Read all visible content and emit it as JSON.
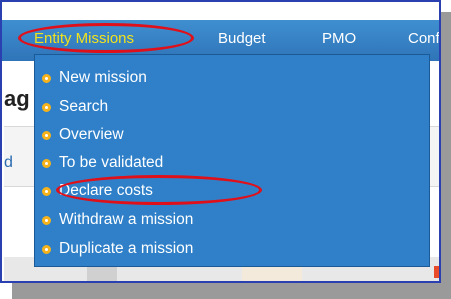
{
  "nav": {
    "items": [
      {
        "label": "Entity Missions",
        "active": true
      },
      {
        "label": "Budget",
        "active": false
      },
      {
        "label": "PMO",
        "active": false
      },
      {
        "label": "Conf",
        "active": false
      }
    ]
  },
  "page": {
    "heading_fragment": "ag",
    "tab_fragment": "d"
  },
  "dropdown": {
    "items": [
      {
        "label": "New mission"
      },
      {
        "label": "Search"
      },
      {
        "label": "Overview"
      },
      {
        "label": "To be validated"
      },
      {
        "label": "Declare costs"
      },
      {
        "label": "Withdraw a mission"
      },
      {
        "label": "Duplicate a mission"
      }
    ]
  },
  "colors": {
    "navbar": "#2f74b8",
    "dropdown": "#2f80c8",
    "active_nav_text": "#f2e21c",
    "highlight_circle": "#e0101a",
    "bullet": "#f6b21a",
    "frame_border": "#2a3fb0"
  }
}
